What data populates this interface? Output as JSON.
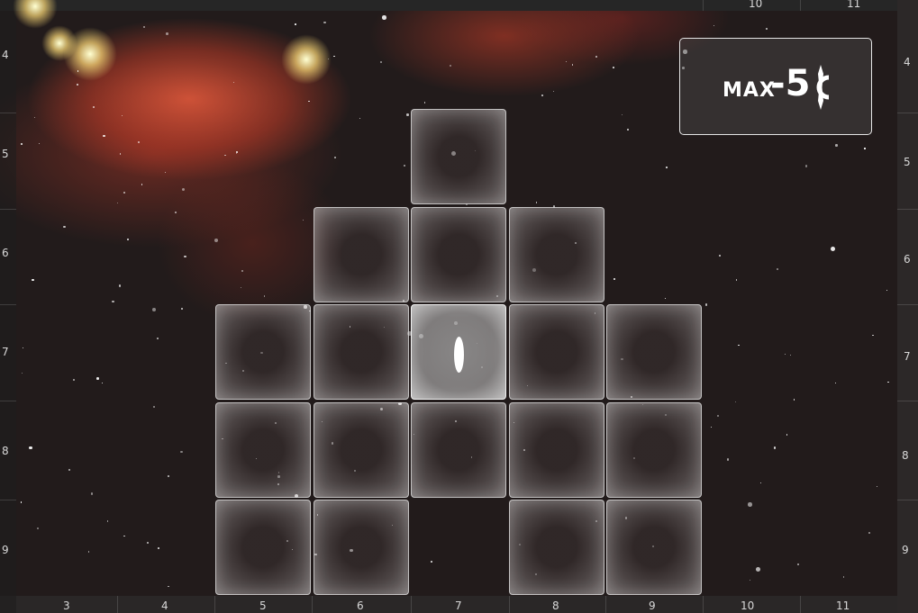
{
  "board": {
    "top_ticks": [
      "10",
      "11"
    ],
    "bottom_ticks": [
      "3",
      "4",
      "5",
      "6",
      "7",
      "8",
      "9",
      "10",
      "11"
    ],
    "left_ticks": [
      "4",
      "5",
      "6",
      "7",
      "8",
      "9"
    ],
    "right_ticks": [
      "4",
      "5",
      "6",
      "7",
      "8",
      "9"
    ]
  },
  "limit": {
    "label": "MAX",
    "value": "-5",
    "icon": "credit-icon"
  },
  "grid": {
    "rows": [
      [
        false,
        false,
        true,
        false,
        false
      ],
      [
        false,
        true,
        true,
        true,
        false
      ],
      [
        true,
        true,
        true,
        true,
        true
      ],
      [
        true,
        true,
        true,
        true,
        true
      ],
      [
        true,
        true,
        false,
        true,
        true
      ]
    ],
    "ship_cell": [
      2,
      2
    ],
    "ship_icon": "ship-icon"
  },
  "colors": {
    "nebula": "#e65a3c",
    "space": "#221b1b",
    "tile_border": "#e6e6e6",
    "text": "#ffffff"
  }
}
